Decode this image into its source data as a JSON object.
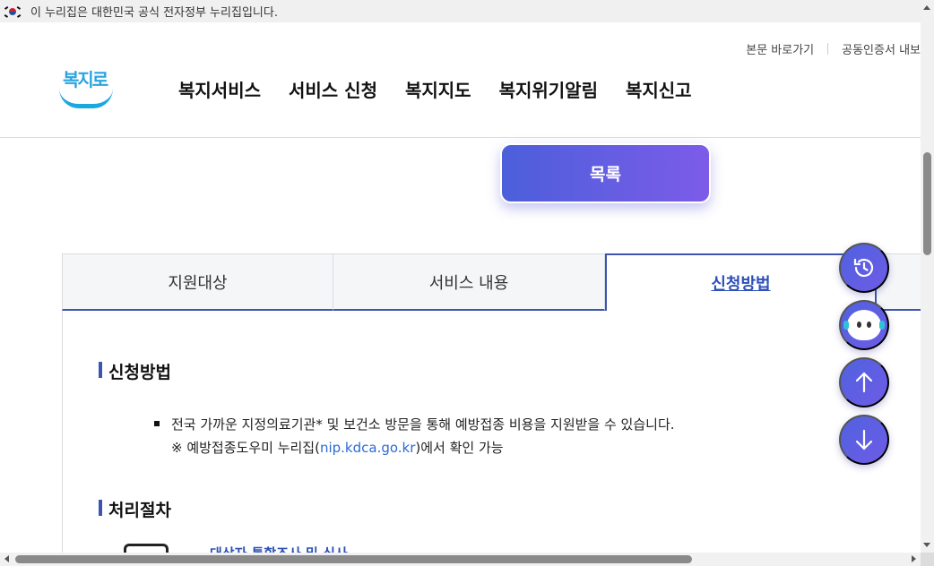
{
  "gov_banner": {
    "text": "이 누리집은 대한민국 공식 전자정부 누리집입니다."
  },
  "util": {
    "skip_link": "본문 바로가기",
    "cert": "공동인증서 내보"
  },
  "logo": {
    "text": "복지로"
  },
  "gnb": [
    "복지서비스",
    "서비스 신청",
    "복지지도",
    "복지위기알림",
    "복지신고"
  ],
  "list_button": "목록",
  "tabs": [
    {
      "label": "지원대상",
      "active": false
    },
    {
      "label": "서비스 내용",
      "active": false
    },
    {
      "label": "신청방법",
      "active": true
    }
  ],
  "section1": {
    "title": "신청방법",
    "bullet": "전국 가까운 지정의료기관* 및 보건소 방문을 통해 예방접종 비용을 지원받을 수 있습니다.",
    "note_prefix": "※ 예방접종도우미 누리집(",
    "note_link": "nip.kdca.go.kr",
    "note_suffix": ")에서 확인 가능"
  },
  "section2": {
    "title": "처리절차",
    "step1": "대상자 통합조사 및 심사"
  },
  "fabs": [
    "recent-icon",
    "chatbot-icon",
    "arrow-up-icon",
    "arrow-down-icon"
  ],
  "colors": {
    "accent": "#3d55b0",
    "button_from": "#4c5fdb",
    "button_to": "#7c5ce8",
    "link": "#2c6bd6"
  }
}
